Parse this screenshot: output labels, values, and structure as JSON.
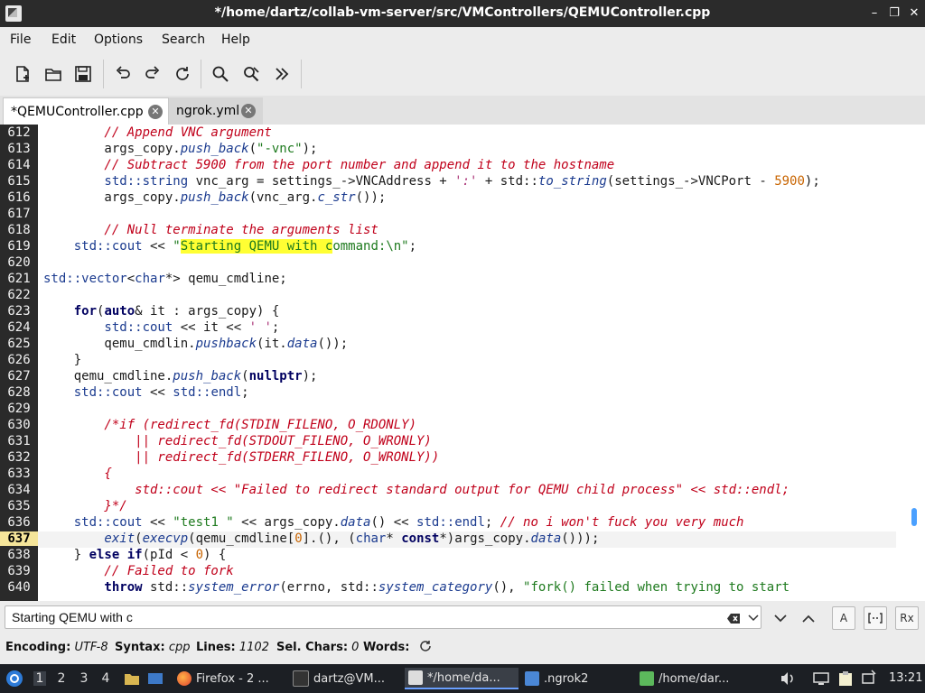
{
  "window": {
    "title": "*/home/dartz/collab-vm-server/src/VMControllers/QEMUController.cpp",
    "min_symbol": "–",
    "restore_symbol": "❐",
    "close_symbol": "✕"
  },
  "menu": [
    "File",
    "Edit",
    "Options",
    "Search",
    "Help"
  ],
  "tabs": [
    {
      "label": "*QEMUController.cpp",
      "active": true,
      "close": "✕"
    },
    {
      "label": "ngrok.yml",
      "active": false,
      "close": "✕"
    }
  ],
  "editor": {
    "current_line": 637,
    "line_numbers": [
      612,
      613,
      614,
      615,
      616,
      617,
      618,
      619,
      620,
      621,
      622,
      623,
      624,
      625,
      626,
      627,
      628,
      629,
      630,
      631,
      632,
      633,
      634,
      635,
      636,
      637,
      638,
      639,
      640
    ],
    "lines": [
      [
        [
          "c",
          "        // Append VNC argument"
        ]
      ],
      [
        [
          "p",
          "        args_copy."
        ],
        [
          "fn",
          "push_back"
        ],
        [
          "p",
          "("
        ],
        [
          "s",
          "\"-vnc\""
        ],
        [
          "p",
          ");"
        ]
      ],
      [
        [
          "c",
          "        // Subtract 5900 from the port number and append it to the hostname"
        ]
      ],
      [
        [
          "ty",
          "        std::string"
        ],
        [
          "p",
          " vnc_arg = settings_->VNCAddress + "
        ],
        [
          "ch",
          "':'"
        ],
        [
          "p",
          " + std::"
        ],
        [
          "fn",
          "to_string"
        ],
        [
          "p",
          "(settings_->VNCPort - "
        ],
        [
          "n",
          "5900"
        ],
        [
          "p",
          ");"
        ]
      ],
      [
        [
          "p",
          "        args_copy."
        ],
        [
          "fn",
          "push_back"
        ],
        [
          "p",
          "(vnc_arg."
        ],
        [
          "fn",
          "c_str"
        ],
        [
          "p",
          "());"
        ]
      ],
      [],
      [
        [
          "c",
          "        // Null terminate the arguments list"
        ]
      ],
      [
        [
          "ns",
          "    std::cout"
        ],
        [
          "p",
          " << "
        ],
        [
          "s",
          "\""
        ],
        [
          "hl",
          "Starting QEMU with c"
        ],
        [
          "s",
          "ommand:\\n\""
        ],
        [
          "p",
          ";"
        ]
      ],
      [],
      [
        [
          "ns",
          "std::vector"
        ],
        [
          "p",
          "<"
        ],
        [
          "ty",
          "char"
        ],
        [
          "p",
          "*> qemu_cmdline;"
        ]
      ],
      [],
      [
        [
          "k",
          "    for"
        ],
        [
          "p",
          "("
        ],
        [
          "k",
          "auto"
        ],
        [
          "p",
          "& it : args_copy) {"
        ]
      ],
      [
        [
          "ns",
          "        std::cout"
        ],
        [
          "p",
          " << it << "
        ],
        [
          "ch",
          "' '"
        ],
        [
          "p",
          ";"
        ]
      ],
      [
        [
          "p",
          "        qemu_cmdlin."
        ],
        [
          "fn",
          "pushback"
        ],
        [
          "p",
          "(it."
        ],
        [
          "fn",
          "data"
        ],
        [
          "p",
          "());"
        ]
      ],
      [
        [
          "p",
          "    }"
        ]
      ],
      [
        [
          "p",
          "    qemu_cmdline."
        ],
        [
          "fn",
          "push_back"
        ],
        [
          "p",
          "("
        ],
        [
          "k",
          "nullptr"
        ],
        [
          "p",
          ");"
        ]
      ],
      [
        [
          "ns",
          "    std::cout"
        ],
        [
          "p",
          " << "
        ],
        [
          "ns",
          "std::endl"
        ],
        [
          "p",
          ";"
        ]
      ],
      [],
      [
        [
          "c",
          "        /*if (redirect_fd(STDIN_FILENO, O_RDONLY)"
        ]
      ],
      [
        [
          "c",
          "            || redirect_fd(STDOUT_FILENO, O_WRONLY)"
        ]
      ],
      [
        [
          "c",
          "            || redirect_fd(STDERR_FILENO, O_WRONLY))"
        ]
      ],
      [
        [
          "c",
          "        {"
        ]
      ],
      [
        [
          "c",
          "            std::cout << \"Failed to redirect standard output for QEMU child process\" << std::endl;"
        ]
      ],
      [
        [
          "c",
          "        }*/"
        ]
      ],
      [
        [
          "ns",
          "    std::cout"
        ],
        [
          "p",
          " << "
        ],
        [
          "s",
          "\"test1 \""
        ],
        [
          "p",
          " << args_copy."
        ],
        [
          "fn",
          "data"
        ],
        [
          "p",
          "() << "
        ],
        [
          "ns",
          "std::endl"
        ],
        [
          "p",
          "; "
        ],
        [
          "c",
          "// no i won't fuck you very much"
        ]
      ],
      [
        [
          "fn",
          "        exit"
        ],
        [
          "p",
          "("
        ],
        [
          "fn",
          "execvp"
        ],
        [
          "p",
          "(qemu_cmdline["
        ],
        [
          "n",
          "0"
        ],
        [
          "p",
          "].(), ("
        ],
        [
          "ty",
          "char"
        ],
        [
          "p",
          "* "
        ],
        [
          "k",
          "const"
        ],
        [
          "p",
          "*)args_copy."
        ],
        [
          "fn",
          "data"
        ],
        [
          "p",
          "()));"
        ]
      ],
      [
        [
          "p",
          "    } "
        ],
        [
          "k",
          "else if"
        ],
        [
          "p",
          "(pId < "
        ],
        [
          "n",
          "0"
        ],
        [
          "p",
          ") {"
        ]
      ],
      [
        [
          "c",
          "        // Failed to fork"
        ]
      ],
      [
        [
          "k",
          "        throw"
        ],
        [
          "p",
          " std::"
        ],
        [
          "fn",
          "system_error"
        ],
        [
          "p",
          "(errno, std::"
        ],
        [
          "fn",
          "system_category"
        ],
        [
          "p",
          "(), "
        ],
        [
          "s",
          "\"fork() failed when trying to start"
        ]
      ]
    ]
  },
  "search": {
    "value": "Starting QEMU with c",
    "placeholder": "",
    "case_label": "A",
    "regex_label": "Rx"
  },
  "status": {
    "encoding_label": "Encoding:",
    "encoding": "UTF-8",
    "syntax_label": "Syntax:",
    "syntax": "cpp",
    "lines_label": "Lines:",
    "lines": "1102",
    "sel_label": "Sel. Chars:",
    "sel": "0",
    "words_label": "Words:"
  },
  "taskbar": {
    "workspaces": [
      "1",
      "2",
      "3",
      "4"
    ],
    "items": [
      {
        "label": "Firefox - 2 ...",
        "icon": "firefox-icon"
      },
      {
        "label": "dartz@VM...",
        "icon": "terminal-icon"
      },
      {
        "label": "*/home/da...",
        "icon": "editor-icon"
      },
      {
        "label": ".ngrok2",
        "icon": "folder-icon"
      },
      {
        "label": "/home/dar...",
        "icon": "terminal-green-icon"
      }
    ],
    "clock": "13:21"
  }
}
